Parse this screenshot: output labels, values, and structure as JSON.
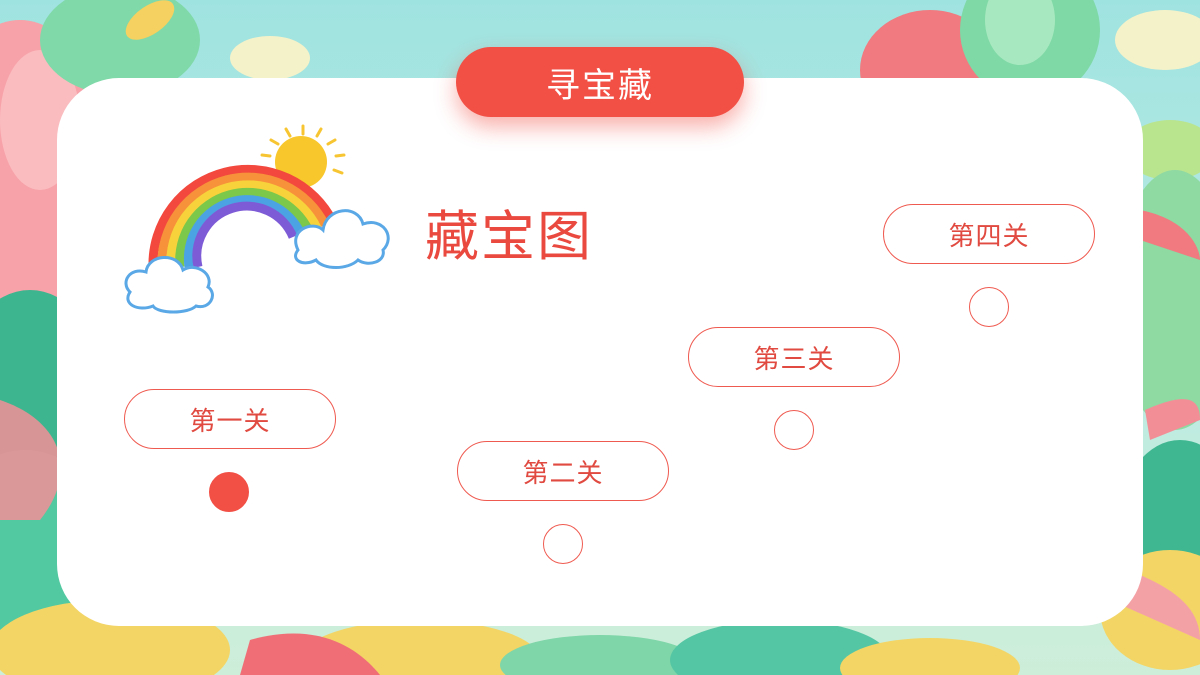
{
  "header": {
    "title": "寻宝藏"
  },
  "map": {
    "title": "藏宝图"
  },
  "levels": [
    {
      "label": "第一关",
      "completed": true
    },
    {
      "label": "第二关",
      "completed": false
    },
    {
      "label": "第三关",
      "completed": false
    },
    {
      "label": "第四关",
      "completed": false
    }
  ],
  "colors": {
    "accent": "#f24f45",
    "outline": "#ef5a50",
    "card": "#ffffff"
  }
}
